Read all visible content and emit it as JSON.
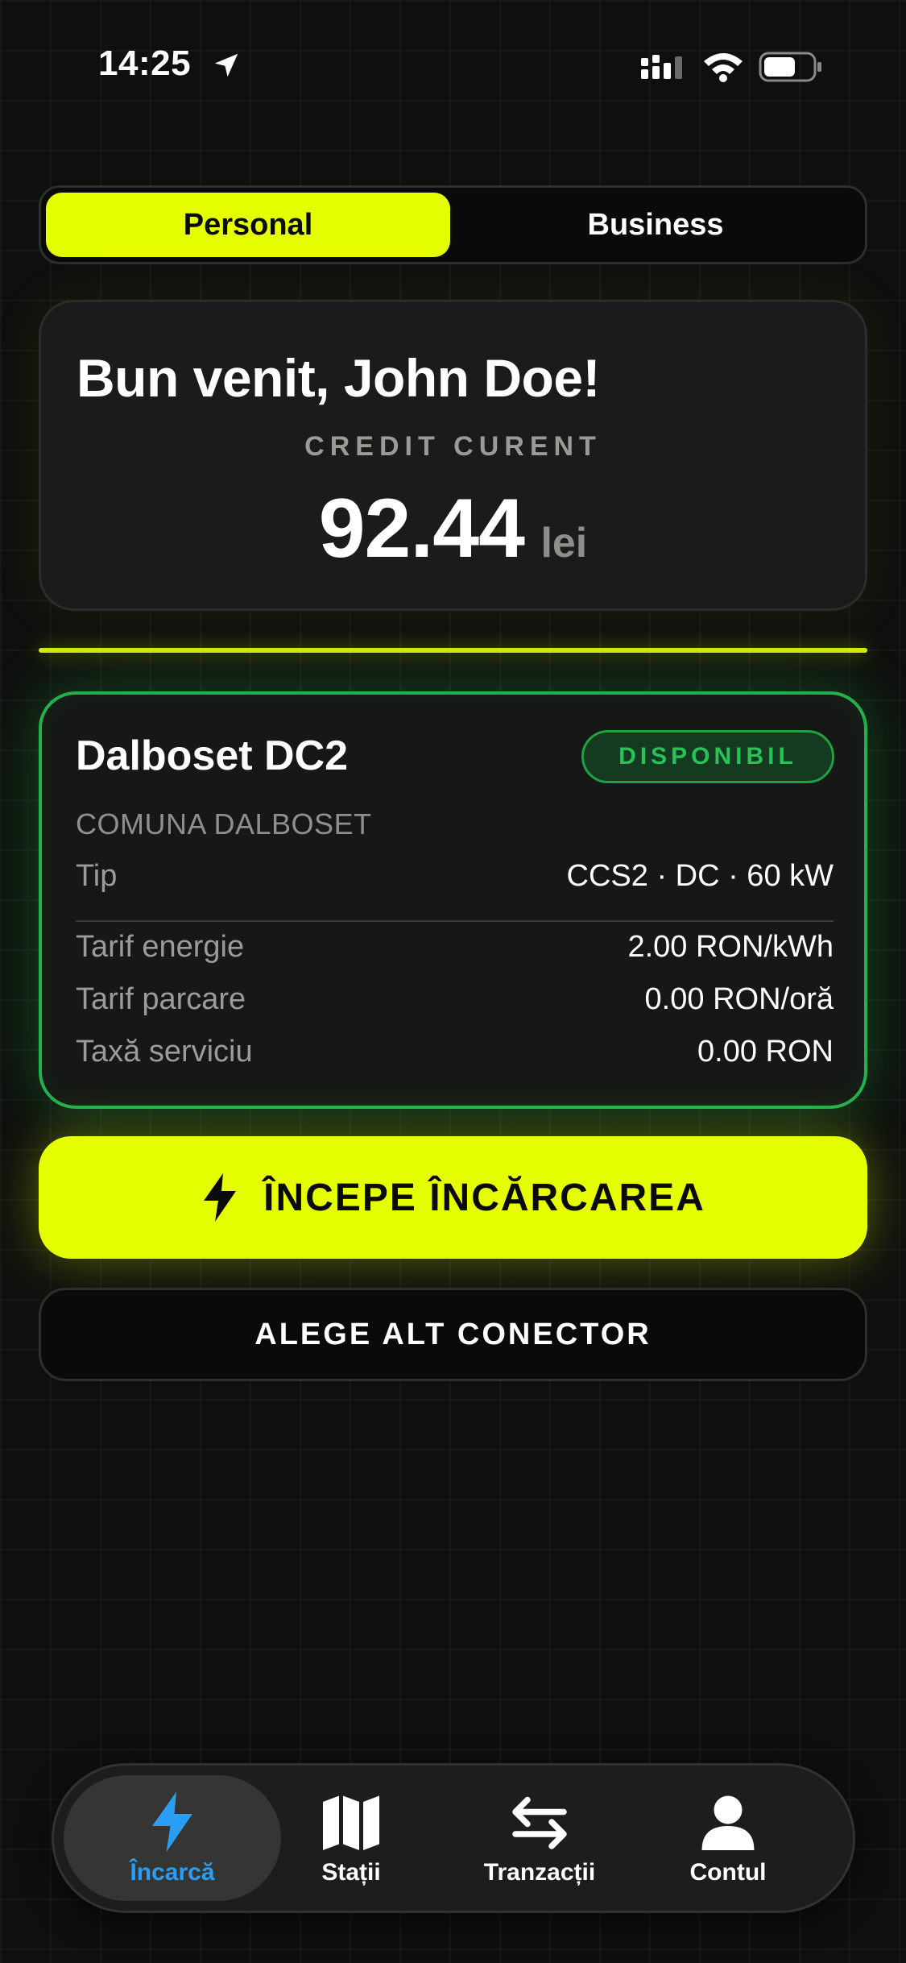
{
  "status_bar": {
    "time": "14:25"
  },
  "account_switch": {
    "personal_label": "Personal",
    "business_label": "Business",
    "selected": "Personal"
  },
  "welcome": {
    "title": "Bun venit, John Doe!",
    "credit_label": "CREDIT CURENT",
    "credit_value": "92.44",
    "credit_unit": "lei"
  },
  "station": {
    "name": "Dalboset DC2",
    "status": "DISPONIBIL",
    "location": "COMUNA DALBOSET",
    "type_label": "Tip",
    "type_value": "CCS2 · DC · 60 kW",
    "energy_label": "Tarif energie",
    "energy_value": "2.00 RON/kWh",
    "parking_label": "Tarif parcare",
    "parking_value": "0.00 RON/oră",
    "fee_label": "Taxă serviciu",
    "fee_value": "0.00 RON"
  },
  "actions": {
    "start_label": "ÎNCEPE ÎNCĂRCAREA",
    "alt_connector_label": "ALEGE ALT CONECTOR"
  },
  "tabbar": {
    "items": [
      {
        "label": "Încarcă",
        "icon": "bolt-icon",
        "active": true
      },
      {
        "label": "Stații",
        "icon": "map-icon",
        "active": false
      },
      {
        "label": "Tranzacții",
        "icon": "arrows-icon",
        "active": false
      },
      {
        "label": "Contul",
        "icon": "person-icon",
        "active": false
      }
    ]
  },
  "colors": {
    "accent": "#e6ff00",
    "available": "#22b14c",
    "active_tab": "#2a9df4",
    "background": "#0f100e"
  }
}
